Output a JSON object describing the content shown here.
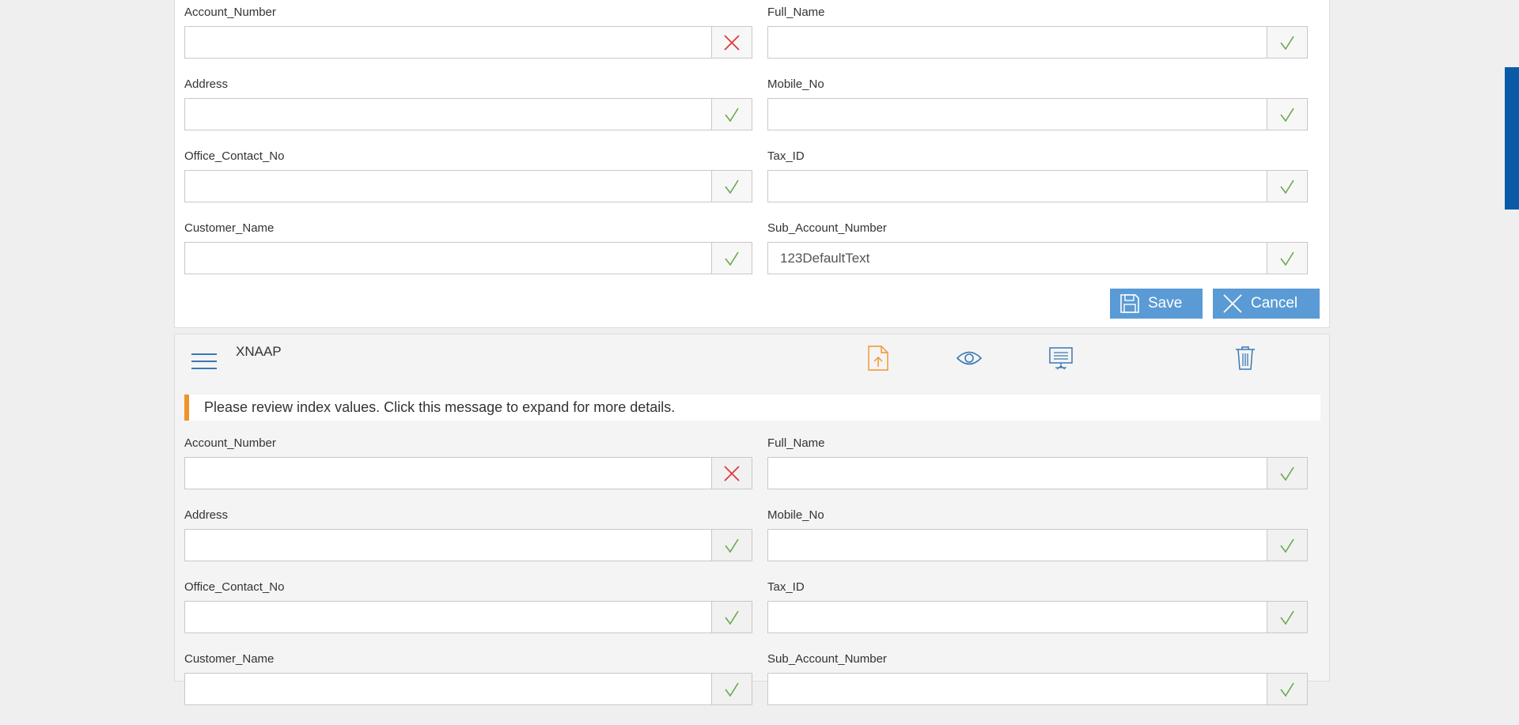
{
  "colors": {
    "accent": "#5a9bd5",
    "icon_blue": "#3a78b5",
    "valid_green": "#6aa84f",
    "invalid_red": "#e0393e",
    "warning_orange": "#f0932b",
    "scrollbar": "#0a5aa8"
  },
  "top_form": {
    "fields": [
      {
        "label": "Account_Number",
        "value": "",
        "status": "invalid",
        "status_icon": "x-icon"
      },
      {
        "label": "Full_Name",
        "value": "",
        "status": "valid",
        "status_icon": "check-icon"
      },
      {
        "label": "Address",
        "value": "",
        "status": "valid",
        "status_icon": "check-icon"
      },
      {
        "label": "Mobile_No",
        "value": "",
        "status": "valid",
        "status_icon": "check-icon"
      },
      {
        "label": "Office_Contact_No",
        "value": "",
        "status": "valid",
        "status_icon": "check-icon"
      },
      {
        "label": "Tax_ID",
        "value": "",
        "status": "valid",
        "status_icon": "check-icon"
      },
      {
        "label": "Customer_Name",
        "value": "",
        "status": "valid",
        "status_icon": "check-icon"
      },
      {
        "label": "Sub_Account_Number",
        "value": "123DefaultText",
        "status": "valid",
        "status_icon": "check-icon"
      }
    ],
    "save_label": "Save",
    "cancel_label": "Cancel"
  },
  "document": {
    "title": "XNAAP",
    "toolbar_icons": [
      "upload-file-icon",
      "eye-icon",
      "presentation-icon",
      "trash-icon"
    ],
    "notice": "Please review index values. Click this message to expand for more details.",
    "fields": [
      {
        "label": "Account_Number",
        "value": "",
        "status": "invalid",
        "status_icon": "x-icon"
      },
      {
        "label": "Full_Name",
        "value": "",
        "status": "valid",
        "status_icon": "check-icon"
      },
      {
        "label": "Address",
        "value": "",
        "status": "valid",
        "status_icon": "check-icon"
      },
      {
        "label": "Mobile_No",
        "value": "",
        "status": "valid",
        "status_icon": "check-icon"
      },
      {
        "label": "Office_Contact_No",
        "value": "",
        "status": "valid",
        "status_icon": "check-icon"
      },
      {
        "label": "Tax_ID",
        "value": "",
        "status": "valid",
        "status_icon": "check-icon"
      },
      {
        "label": "Customer_Name",
        "value": "",
        "status": "valid",
        "status_icon": "check-icon"
      },
      {
        "label": "Sub_Account_Number",
        "value": "",
        "status": "valid",
        "status_icon": "check-icon"
      }
    ]
  }
}
